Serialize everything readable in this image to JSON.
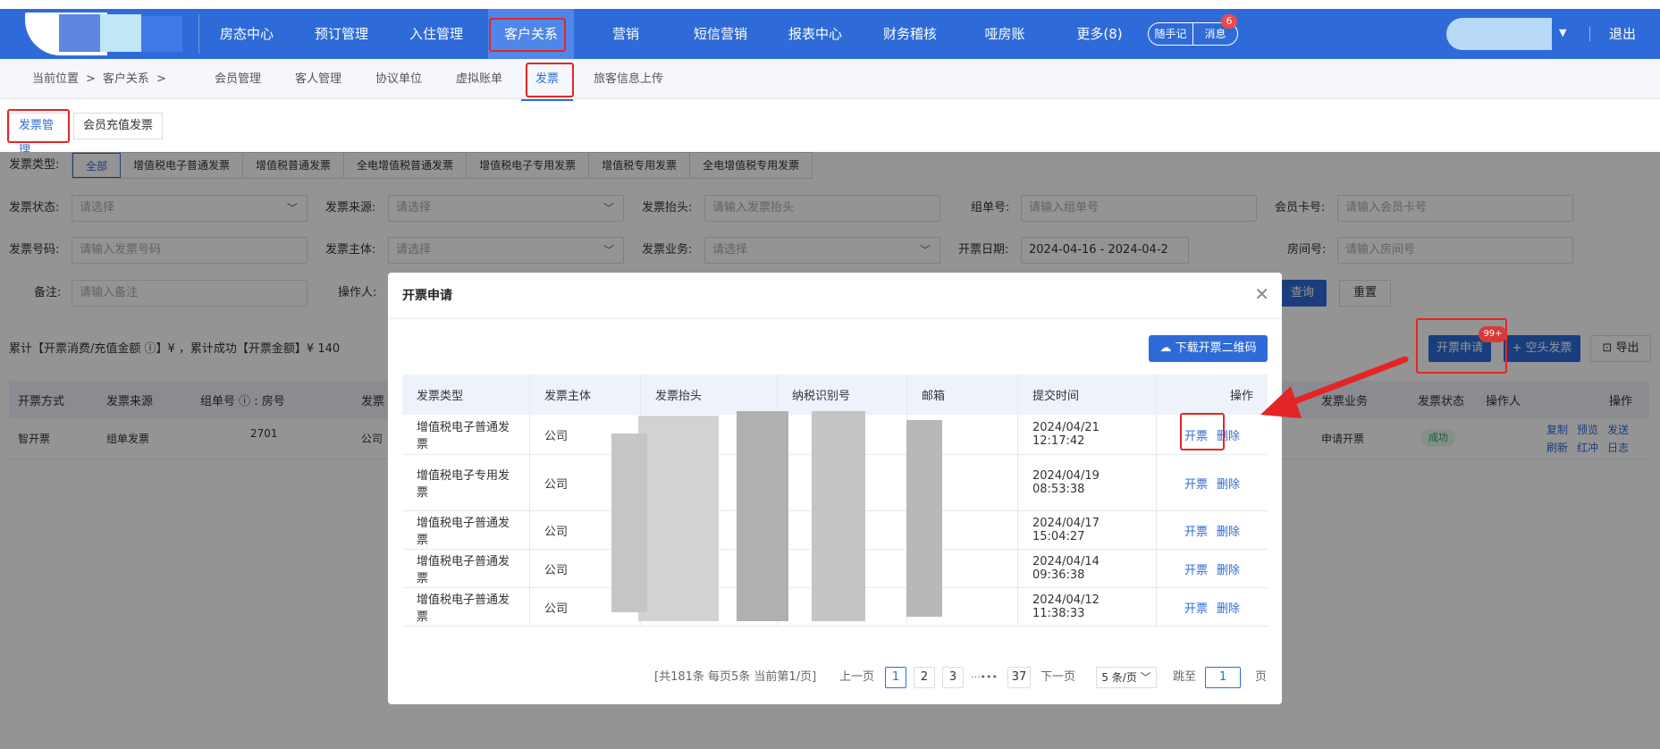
{
  "nav": {
    "items": [
      "房态中心",
      "预订管理",
      "入住管理",
      "客户关系",
      "营销",
      "短信营销",
      "报表中心",
      "财务稽核",
      "哑房账",
      "更多(8)"
    ],
    "notes": "随手记",
    "messages": "消息",
    "message_count": "6",
    "logout": "退出"
  },
  "subnav": {
    "location_label": "当前位置",
    "crumb_sep": ">",
    "crumb_current": "客户关系",
    "tabs": [
      "会员管理",
      "客人管理",
      "协议单位",
      "虚拟账单",
      "发票",
      "旅客信息上传"
    ]
  },
  "page_tabs": [
    "发票管理",
    "会员充值发票"
  ],
  "filters": {
    "type_label": "发票类型:",
    "types": [
      "全部",
      "增值税电子普通发票",
      "增值税普通发票",
      "全电增值税普通发票",
      "增值税电子专用发票",
      "增值税专用发票",
      "全电增值税专用发票"
    ],
    "status_label": "发票状态:",
    "status_ph": "请选择",
    "source_label": "发票来源:",
    "source_ph": "请选择",
    "title_label": "发票抬头:",
    "title_ph": "请输入发票抬头",
    "group_label": "组单号:",
    "group_ph": "请输入组单号",
    "card_label": "会员卡号:",
    "card_ph": "请输入会员卡号",
    "number_label": "发票号码:",
    "number_ph": "请输入发票号码",
    "subject_label": "发票主体:",
    "subject_ph": "请选择",
    "business_label": "发票业务:",
    "business_ph": "请选择",
    "date_label": "开票日期:",
    "date_value": "2024-04-16 - 2024-04-2",
    "room_label": "房间号:",
    "room_ph": "请输入房间号",
    "remark_label": "备注:",
    "remark_ph": "请输入备注",
    "operator_label": "操作人:",
    "query": "查询",
    "reset": "重置"
  },
  "summary": "累计【开票消费/充值金额 ⓘ】¥ ，累计成功【开票金额】¥ 140",
  "actions": {
    "apply": "开票申请",
    "apply_badge": "99+",
    "blank": "+ 空头发票",
    "export": "⊡ 导出"
  },
  "main_table": {
    "headers": [
      "开票方式",
      "发票来源",
      "组单号 ⓘ : 房号",
      "发票",
      "发票业务",
      "发票状态",
      "操作人",
      "操作"
    ],
    "row": {
      "method": "智开票",
      "source": "组单发票",
      "group_room": "2701",
      "subject": "公司",
      "business": "申请开票",
      "status": "成功",
      "ops": [
        "复制",
        "预览",
        "发送",
        "刷新",
        "红冲",
        "日志"
      ]
    }
  },
  "modal": {
    "title": "开票申请",
    "qr_button": "下载开票二维码",
    "headers": [
      "发票类型",
      "发票主体",
      "发票抬头",
      "纳税识别号",
      "邮箱",
      "提交时间",
      "操作"
    ],
    "rows": [
      {
        "type": "增值税电子普通发票",
        "subject": "公司",
        "time": "2024/04/21 12:17:42"
      },
      {
        "type": "增值税电子专用发票",
        "subject": "公司",
        "time": "2024/04/19 08:53:38"
      },
      {
        "type": "增值税电子普通发票",
        "subject": "公司",
        "time": "2024/04/17 15:04:27"
      },
      {
        "type": "增值税电子普通发票",
        "subject": "公司",
        "time": "2024/04/14 09:36:38"
      },
      {
        "type": "增值税电子普通发票",
        "subject": "公司",
        "time": "2024/04/12 11:38:33"
      }
    ],
    "op_issue": "开票",
    "op_delete": "删除",
    "pager": {
      "info": "[共181条 每页5条 当前第1/页]",
      "prev": "上一页",
      "pages": [
        "1",
        "2",
        "3"
      ],
      "ellipsis": "···•••",
      "last": "37",
      "next": "下一页",
      "size": "5 条/页",
      "jump_label": "跳至",
      "jump_value": "1",
      "page_unit": "页"
    }
  }
}
